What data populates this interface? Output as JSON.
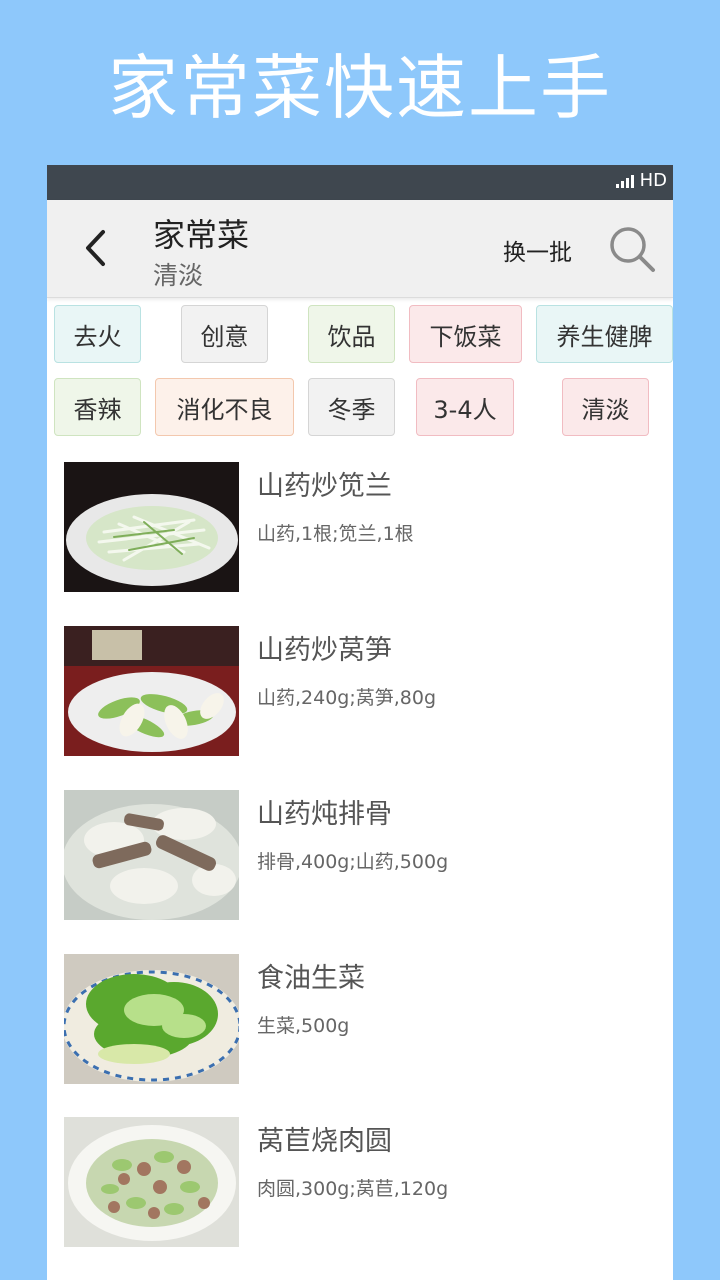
{
  "promo": {
    "title": "家常菜快速上手"
  },
  "status_bar": {
    "network": "HD"
  },
  "header": {
    "title": "家常菜",
    "subtitle": "清淡",
    "refresh_label": "换一批"
  },
  "tags": [
    {
      "label": "去火"
    },
    {
      "label": "创意"
    },
    {
      "label": "饮品"
    },
    {
      "label": "下饭菜"
    },
    {
      "label": "养生健脾"
    },
    {
      "label": "香辣"
    },
    {
      "label": "消化不良"
    },
    {
      "label": "冬季"
    },
    {
      "label": "3-4人"
    },
    {
      "label": "清淡"
    }
  ],
  "recipes": [
    {
      "name": "山药炒笕兰",
      "ingredients": "山药,1根;笕兰,1根"
    },
    {
      "name": "山药炒莴笋",
      "ingredients": "山药,240g;莴笋,80g"
    },
    {
      "name": "山药炖排骨",
      "ingredients": "排骨,400g;山药,500g"
    },
    {
      "name": "食油生菜",
      "ingredients": "生菜,500g"
    },
    {
      "name": "莴苣烧肉圆",
      "ingredients": "肉圆,300g;莴苣,120g"
    }
  ]
}
